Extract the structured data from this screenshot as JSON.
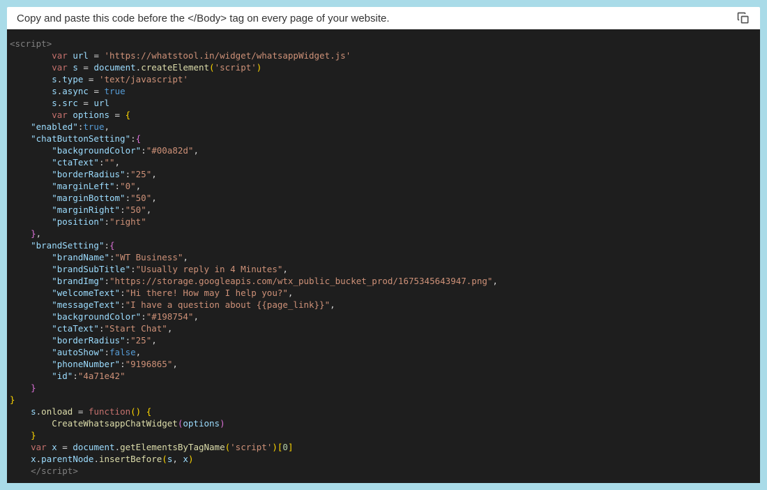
{
  "header": {
    "instruction": "Copy and paste this code before the </Body> tag on every page of your website."
  },
  "code": {
    "url": "https://whatstool.in/widget/whatsappWidget.js",
    "scriptType": "text/javascript",
    "asyncValue": "true",
    "enabled": "true",
    "chatButton": {
      "backgroundColor": "#00a82d",
      "ctaText": "",
      "borderRadius": "25",
      "marginLeft": "0",
      "marginBottom": "50",
      "marginRight": "50",
      "position": "right"
    },
    "brand": {
      "brandName": "WT Business",
      "brandSubTitle": "Usually reply in 4 Minutes",
      "brandImg": "https://storage.googleapis.com/wtx_public_bucket_prod/1675345643947.png",
      "welcomeText": "Hi there! How may I help you?",
      "messageText": "I have a question about {{page_link}}",
      "backgroundColor": "#198754",
      "ctaText": "Start Chat",
      "borderRadius": "25",
      "autoShow": "false",
      "phoneNumber": "9196865",
      "id": "4a71e42"
    }
  }
}
